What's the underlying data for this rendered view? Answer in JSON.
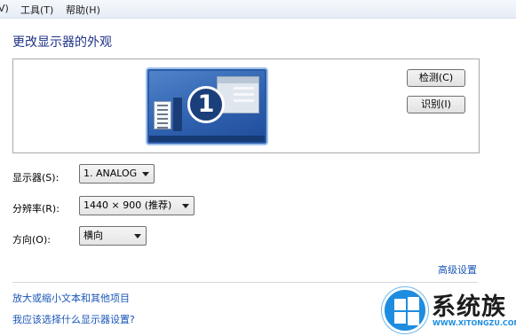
{
  "menu": {
    "partial_item": "V)",
    "tools": "工具(T)",
    "help": "帮助(H)"
  },
  "page_title": "更改显示器的外观",
  "monitor_badge": "1",
  "buttons": {
    "detect": "检测(C)",
    "identify": "识别(I)"
  },
  "fields": {
    "display_label": "显示器(S):",
    "display_value": "1. ANALOG",
    "resolution_label": "分辨率(R):",
    "resolution_value": "1440 × 900 (推荐)",
    "orientation_label": "方向(O):",
    "orientation_value": "横向"
  },
  "links": {
    "advanced": "高级设置",
    "text_size": "放大或缩小文本和其他项目",
    "which_settings": "我应该选择什么显示器设置?"
  },
  "watermark": {
    "title": "系统族",
    "url": "WWW.XITONGZU.COM"
  },
  "colors": {
    "title": "#1e3287",
    "link": "#1a56b8",
    "monitor": "#2f62b0",
    "watermark_logo": "#1e8de0"
  }
}
